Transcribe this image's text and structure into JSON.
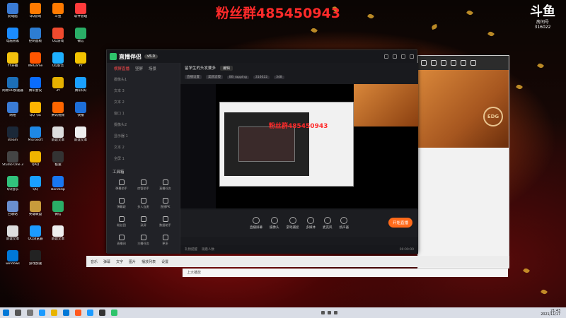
{
  "overlay_text": "粉丝群485450943",
  "nested_overlay_text": "粉丝群485450943",
  "douyu": {
    "logo": "斗鱼",
    "room_label": "房间号",
    "room_id": "316022"
  },
  "desktop_icons": [
    {
      "label": "此电脑",
      "color": "#3a7bd5"
    },
    {
      "label": "电脑管家",
      "color": "#1b8cff"
    },
    {
      "label": "YY开播",
      "color": "#f4c20d"
    },
    {
      "label": "网易UU加速器",
      "color": "#1c6fb8"
    },
    {
      "label": "网络",
      "color": "#3a7bd5"
    },
    {
      "label": "steam",
      "color": "#1b2838"
    },
    {
      "label": "Studio One 3",
      "color": "#444"
    },
    {
      "label": "QQ音乐",
      "color": "#31c27c"
    },
    {
      "label": "回收站",
      "color": "#6a8fd0"
    },
    {
      "label": "新建文本",
      "color": "#ddd"
    },
    {
      "label": "windows",
      "color": "#0078d7"
    },
    {
      "label": "QQ游戏",
      "color": "#ff7a00"
    },
    {
      "label": "控制面板",
      "color": "#2d7dd2"
    },
    {
      "label": "WeGame",
      "color": "#ff5500"
    },
    {
      "label": "腾讯会议",
      "color": "#0a6cff"
    },
    {
      "label": "QQ飞车",
      "color": "#ffb400"
    },
    {
      "label": "Microsoft",
      "color": "#1e88e5"
    },
    {
      "label": "QAQ",
      "color": "#f0b400"
    },
    {
      "label": "QQ",
      "color": "#1aa0ff"
    },
    {
      "label": "英雄联盟",
      "color": "#c89b3c"
    },
    {
      "label": "QQ浏览器",
      "color": "#1c9bff"
    },
    {
      "label": "游戏加速",
      "color": "#222"
    },
    {
      "label": "斗鱼",
      "color": "#ff7a00"
    },
    {
      "label": "QQ游戏",
      "color": "#f04a2e"
    },
    {
      "label": "QQ影音",
      "color": "#1eb0ff"
    },
    {
      "label": "3Y",
      "color": "#e6b100"
    },
    {
      "label": "腾讯视频",
      "color": "#ff6600"
    },
    {
      "label": "新建文本",
      "color": "#ddd"
    },
    {
      "label": "极速",
      "color": "#333"
    },
    {
      "label": "Bandizip",
      "color": "#1877f2"
    },
    {
      "label": "微信",
      "color": "#2aae67"
    },
    {
      "label": "新建文本",
      "color": "#eee"
    },
    {
      "label": "软件管理",
      "color": "#ff3b3b"
    },
    {
      "label": "微信",
      "color": "#2aae67"
    },
    {
      "label": "YY",
      "color": "#f3c300"
    },
    {
      "label": "腾讯QQ",
      "color": "#1aa0ff"
    },
    {
      "label": "快播",
      "color": "#1e6fd9"
    },
    {
      "label": "新建文本",
      "color": "#eee"
    }
  ],
  "obs": {
    "brand": "直播伴侣",
    "version": "v5.0",
    "tabs": [
      "横屏直播",
      "竖屏",
      "场景"
    ],
    "scenes": [
      "摄像头1",
      "文本 3",
      "文本 2",
      "窗口 1",
      "摄像头2",
      "显示器 1",
      "文本 2",
      "全屏 1"
    ],
    "tools_title": "工具箱",
    "tools": [
      "弹幕助手",
      "房管助手",
      "直播任务",
      "弹幕姬",
      "多人连麦",
      "直播PK",
      "粉丝团",
      "录屏",
      "数据助手",
      "直播间",
      "主播任务",
      "更多"
    ],
    "preview_title": "留学生的头发要多",
    "preview_btn": "编辑",
    "chips": [
      "直播设置",
      "美颜滤镜",
      "BB rapping",
      "316022",
      "348"
    ],
    "bottom_tools": [
      "直播屏幕",
      "摄像头",
      "游戏捕捉",
      "多媒体",
      "麦克风",
      "扬声器"
    ],
    "go_live": "开始直播",
    "status": [
      "礼物提醒",
      "观看人数",
      "00:00:00"
    ]
  },
  "browser": {
    "badge": "EDG"
  },
  "strip1": {
    "items": [
      "音乐",
      "弹幕",
      "文字",
      "图片",
      "播放列表",
      "设置"
    ]
  },
  "strip2": {
    "text": "上大播放"
  },
  "taskbar": {
    "time": "21:43",
    "date": "2021/11/17"
  }
}
